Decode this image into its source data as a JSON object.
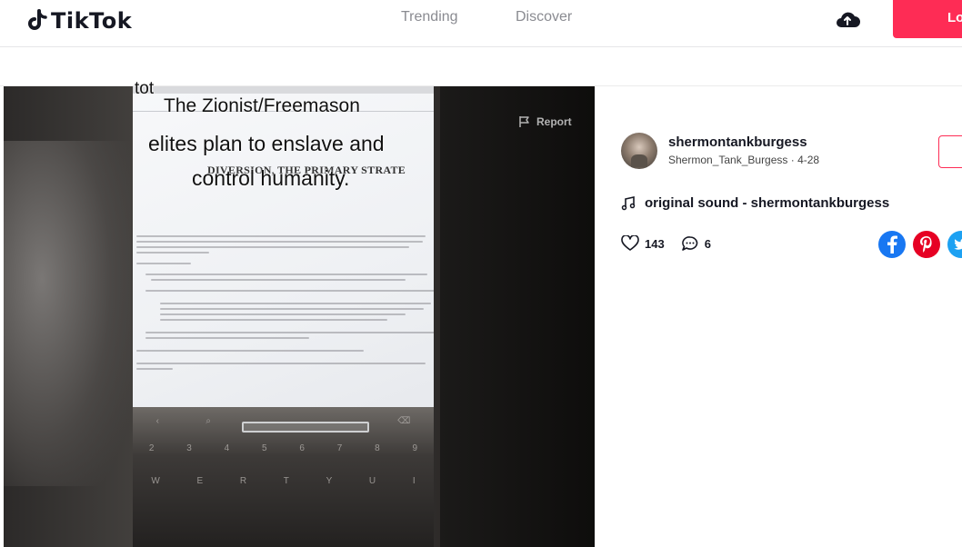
{
  "header": {
    "logo_text": "TikTok",
    "nav": {
      "trending": "Trending",
      "discover": "Discover"
    },
    "login_label": "Lo"
  },
  "video": {
    "overlay_lines": [
      "tot",
      "The Zionist/Freemason",
      "elites plan to enslave and",
      "control humanity."
    ],
    "doc_heading": "DIVERSION, THE PRIMARY STRATE",
    "report_label": "Report"
  },
  "author": {
    "username": "shermontankburgess",
    "nickname_date": "Shermon_Tank_Burgess · 4-28"
  },
  "music": {
    "label": "original sound - shermontankburgess"
  },
  "stats": {
    "likes": "143",
    "comments": "6"
  },
  "share": [
    "facebook-icon",
    "pinterest-icon",
    "twitter-icon"
  ],
  "colors": {
    "accent": "#fe2c55",
    "facebook": "#1877f2",
    "pinterest": "#e60023",
    "twitter": "#1da1f2"
  }
}
